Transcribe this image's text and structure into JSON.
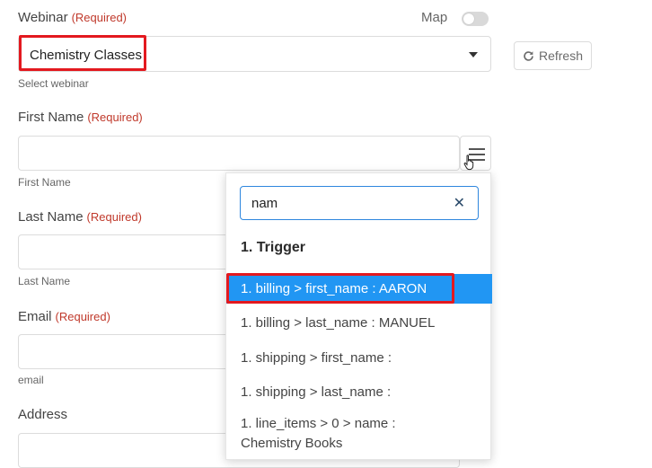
{
  "webinar": {
    "label": "Webinar",
    "required": "(Required)",
    "value": "Chemistry Classes",
    "hint": "Select webinar",
    "map_label": "Map",
    "refresh_label": "Refresh"
  },
  "first_name": {
    "label": "First Name",
    "required": "(Required)",
    "hint": "First Name"
  },
  "last_name": {
    "label": "Last Name",
    "required": "(Required)",
    "hint": "Last Name"
  },
  "email": {
    "label": "Email",
    "required": "(Required)",
    "hint": "email"
  },
  "address": {
    "label": "Address"
  },
  "dropdown": {
    "search_value": "nam",
    "group_title": "1. Trigger",
    "options": [
      "1. billing > first_name : AARON",
      "1. billing > last_name : MANUEL",
      "1. shipping > first_name :",
      "1. shipping > last_name :",
      "1. line_items > 0 > name :",
      "Chemistry Books"
    ]
  },
  "colors": {
    "accent": "#2196f3",
    "required": "#c0392b",
    "highlight_border": "#e3191f"
  }
}
